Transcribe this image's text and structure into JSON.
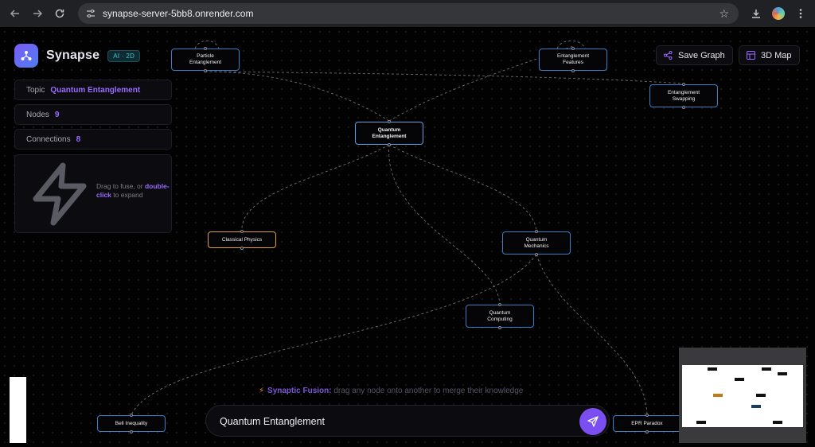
{
  "browser": {
    "url": "synapse-server-5bb8.onrender.com",
    "back_icon": "arrow-left-icon",
    "forward_icon": "arrow-right-icon",
    "reload_icon": "reload-icon",
    "site_settings_icon": "tune-icon",
    "bookmark_icon": "star-icon",
    "download_icon": "download-icon",
    "menu_icon": "kebab-menu-icon"
  },
  "app": {
    "name": "Synapse",
    "badge": "AI · 2D",
    "accent_color": "#9b6bff",
    "stats": {
      "topic_label": "Topic",
      "topic_value": "Quantum Entanglement",
      "nodes_label": "Nodes",
      "nodes_value": "9",
      "connections_label": "Connections",
      "connections_value": "8"
    },
    "hint": {
      "prefix": "Drag to fuse, or",
      "emphasis": "double-click",
      "suffix": "to expand"
    },
    "toolbar": {
      "save_label": "Save Graph",
      "map_label": "3D Map"
    },
    "fusion_hint": {
      "title": "Synaptic Fusion:",
      "text": "drag any node onto another to merge their knowledge"
    },
    "chat": {
      "value": "Quantum Entanglement"
    }
  },
  "graph": {
    "nodes": {
      "particle_entanglement": {
        "line1": "Particle",
        "line2": "Entanglement"
      },
      "entanglement_features": {
        "line1": "Entanglement",
        "line2": "Features"
      },
      "entanglement_swapping": {
        "line1": "Entanglement",
        "line2": "Swapping"
      },
      "quantum_entanglement": {
        "line1": "Quantum",
        "line2": "Entanglement"
      },
      "classical_physics": {
        "line1": "Classical Physics",
        "line2": ""
      },
      "quantum_mechanics": {
        "line1": "Quantum",
        "line2": "Mechanics"
      },
      "quantum_computing": {
        "line1": "Quantum",
        "line2": "Computing"
      },
      "bell_inequality": {
        "line1": "Bell Inequality",
        "line2": ""
      },
      "epr_paradox": {
        "line1": "EPR Paradox",
        "line2": ""
      }
    }
  }
}
